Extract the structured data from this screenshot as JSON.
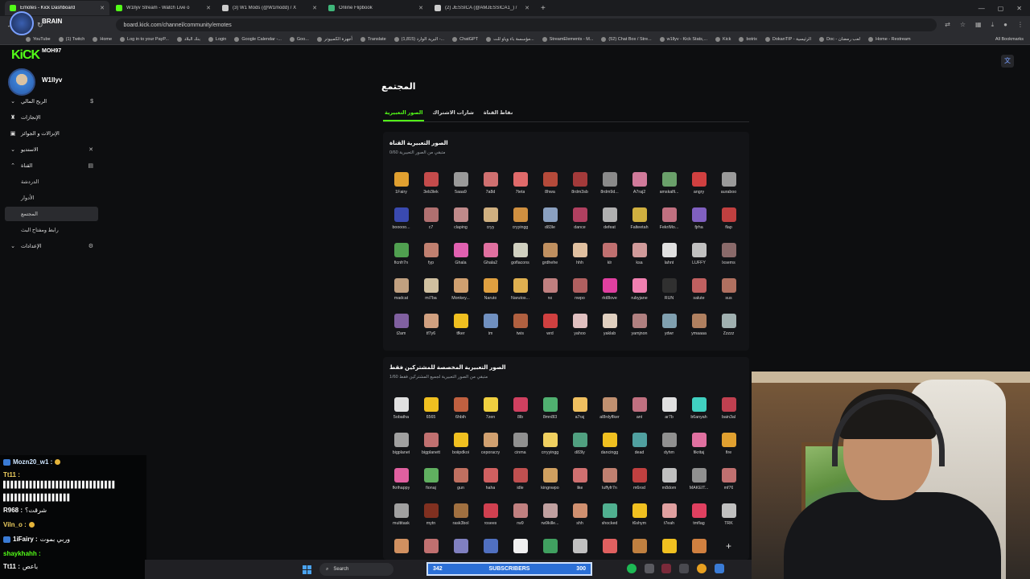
{
  "browser": {
    "tabs": [
      {
        "label": "Emotes - Kick Dashboard",
        "active": true,
        "color": "#53fc18"
      },
      {
        "label": "W1llyv Stream - Watch Live o",
        "active": false,
        "color": "#53fc18"
      },
      {
        "label": "(3) W1 Mods (@W1modd) / X",
        "active": false,
        "color": "#cccccc"
      },
      {
        "label": "Online Flipbook",
        "active": false,
        "color": "#3fb67a"
      },
      {
        "label": "(2) JESSICA (@AMJESSICA1_) /",
        "active": false,
        "color": "#cccccc"
      }
    ],
    "new_tab": "+",
    "url": "board.kick.com/channel/community/emotes",
    "bookmarks": [
      "YouTube",
      "(1) Twitch",
      "Home",
      "Log in to your PayP...",
      "بنك البلاد",
      "Login",
      "Google Calendar -...",
      "Goo...",
      "أجهزة الكمبيوتر",
      "Translate",
      "(1,815) البريد الوارد -...",
      "ChatGPT",
      "مؤسسة باء وياو للت...",
      "StreamElements - M...",
      "(52) Chat Box / Stre...",
      "w1llyv - Kick Stats,...",
      "Kick",
      "botrix",
      "DokanTIP - الرئيسية",
      "Doc - لعب رمضان",
      "Home - Restream"
    ],
    "all_bookmarks": "All Bookmarks"
  },
  "overlay": {
    "top_label": "BRAIN",
    "logo": "KiCK",
    "chatter_label": "MOH97"
  },
  "sidebar": {
    "username": "W1llyv",
    "items": [
      {
        "label": "الربح المالي",
        "icon": "$"
      },
      {
        "label": "الإنجازات",
        "icon": "🏆"
      },
      {
        "label": "الإنزالات و الجوائز",
        "icon": "🎁"
      },
      {
        "label": "الاستديو",
        "icon": "▣"
      },
      {
        "label": "القناة",
        "icon": "▤"
      },
      {
        "label": "الدردشة",
        "icon": ""
      },
      {
        "label": "الأدوار",
        "icon": ""
      },
      {
        "label": "المجتمع",
        "icon": ""
      },
      {
        "label": "رابط ومفتاح البث",
        "icon": ""
      },
      {
        "label": "الإعدادات",
        "icon": "⚙"
      }
    ]
  },
  "main": {
    "title": "المجتمع",
    "tabs": [
      {
        "label": "الصور التعبيرية",
        "active": true
      },
      {
        "label": "شارات الاشتراك",
        "active": false
      },
      {
        "label": "نقاط القناة",
        "active": false
      }
    ],
    "channel_emotes": {
      "title": "الصور التعبيرية القناة",
      "subtitle": "متبقي من الصور التعبيرية 0/60",
      "emotes": [
        {
          "name": "1Fairy",
          "color": "#e0a030"
        },
        {
          "name": "3eb3lek",
          "color": "#c44b4b"
        },
        {
          "name": "5aaa9",
          "color": "#9a9a9a"
        },
        {
          "name": "7a8d",
          "color": "#d07070"
        },
        {
          "name": "7teta",
          "color": "#e06a6a"
        },
        {
          "name": "8hwa",
          "color": "#b54a3a"
        },
        {
          "name": "8rdm3sb",
          "color": "#a33a3a"
        },
        {
          "name": "8rdm9d...",
          "color": "#8a8a8a"
        },
        {
          "name": "A7raj2",
          "color": "#d07a9a"
        },
        {
          "name": "amskalfi...",
          "color": "#6aa06a"
        },
        {
          "name": "angry",
          "color": "#d04040"
        },
        {
          "name": "auraboo",
          "color": "#9a9a9a"
        },
        {
          "name": "booooo...",
          "color": "#3a4ab0"
        },
        {
          "name": "c7",
          "color": "#b07070"
        },
        {
          "name": "claping",
          "color": "#c08a8a"
        },
        {
          "name": "cryy",
          "color": "#d0b080"
        },
        {
          "name": "cryyingg",
          "color": "#d09040"
        },
        {
          "name": "d83le",
          "color": "#8aa0c0"
        },
        {
          "name": "dance",
          "color": "#b04060"
        },
        {
          "name": "defeat",
          "color": "#b0b0b0"
        },
        {
          "name": "Falteetah",
          "color": "#d0b040"
        },
        {
          "name": "FekriMo...",
          "color": "#c07080"
        },
        {
          "name": "fjrha",
          "color": "#8060c0"
        },
        {
          "name": "flap",
          "color": "#c04040"
        },
        {
          "name": "ficnfr7n",
          "color": "#50a050"
        },
        {
          "name": "fyp",
          "color": "#c08070"
        },
        {
          "name": "Ghala",
          "color": "#e060b0"
        },
        {
          "name": "Ghala2",
          "color": "#e070a0"
        },
        {
          "name": "goflacons",
          "color": "#d0d0c0"
        },
        {
          "name": "grdhehe",
          "color": "#c09060"
        },
        {
          "name": "hhh",
          "color": "#e0c0a0"
        },
        {
          "name": "klr",
          "color": "#c07070"
        },
        {
          "name": "ksa",
          "color": "#d09a9a"
        },
        {
          "name": "lahnt",
          "color": "#e0e0e0"
        },
        {
          "name": "LUFFY",
          "color": "#c0c0c0"
        },
        {
          "name": "lxsems",
          "color": "#8a6a6a"
        },
        {
          "name": "madcat",
          "color": "#c0a080"
        },
        {
          "name": "mi7ba",
          "color": "#d0c0a0"
        },
        {
          "name": "Monkey...",
          "color": "#d0a070"
        },
        {
          "name": "Naruto",
          "color": "#e0a040"
        },
        {
          "name": "Narutos...",
          "color": "#e0b050"
        },
        {
          "name": "no",
          "color": "#c08080"
        },
        {
          "name": "nwpo",
          "color": "#b06060"
        },
        {
          "name": "rkt8love",
          "color": "#e040a0"
        },
        {
          "name": "rubyjane",
          "color": "#f080b0"
        },
        {
          "name": "RUN",
          "color": "#303030"
        },
        {
          "name": "salute",
          "color": "#c06060"
        },
        {
          "name": "sus",
          "color": "#b07060"
        },
        {
          "name": "t2am",
          "color": "#8060a0"
        },
        {
          "name": "tf7y6",
          "color": "#d0a080"
        },
        {
          "name": "tfker",
          "color": "#f0c020"
        },
        {
          "name": "tm",
          "color": "#7090c0"
        },
        {
          "name": "twis",
          "color": "#b06040"
        },
        {
          "name": "wrd",
          "color": "#d04040"
        },
        {
          "name": "yahoo",
          "color": "#e0c0c0"
        },
        {
          "name": "yaklab",
          "color": "#e0d0c0"
        },
        {
          "name": "yamjnon",
          "color": "#b08080"
        },
        {
          "name": "ydwr",
          "color": "#80a0b0"
        },
        {
          "name": "ymaaaa",
          "color": "#b08060"
        },
        {
          "name": "Zzzzz",
          "color": "#a0b0b0"
        }
      ]
    },
    "subscriber_emotes": {
      "title": "الصور التعبيرية المخصصة للمشتركين فقط",
      "subtitle": "متبقي من الصور التعبيرية لجميع المشتركين فقط 1/60",
      "emotes": [
        {
          "name": "5obatha",
          "color": "#e0e0e0"
        },
        {
          "name": "6565",
          "color": "#f0c020"
        },
        {
          "name": "6hbih",
          "color": "#c06040"
        },
        {
          "name": "7zen",
          "color": "#f0d040"
        },
        {
          "name": "8lb",
          "color": "#d04060"
        },
        {
          "name": "8mn8l3",
          "color": "#50b070"
        },
        {
          "name": "a7raj",
          "color": "#f0c060"
        },
        {
          "name": "al8rdyflker",
          "color": "#c09070"
        },
        {
          "name": "ant",
          "color": "#c07080"
        },
        {
          "name": "ar7b",
          "color": "#e0e0e0"
        },
        {
          "name": "b6anyah",
          "color": "#40d0c0"
        },
        {
          "name": "bain3al",
          "color": "#c04050"
        },
        {
          "name": "bigplanet",
          "color": "#a0a0a0"
        },
        {
          "name": "bigplanett",
          "color": "#c07070"
        },
        {
          "name": "boiipdkoi",
          "color": "#f0c020"
        },
        {
          "name": "ceporacry",
          "color": "#d0a070"
        },
        {
          "name": "cinma",
          "color": "#909090"
        },
        {
          "name": "crryyingg",
          "color": "#f0d060"
        },
        {
          "name": "d83ly",
          "color": "#50a080"
        },
        {
          "name": "dancingg",
          "color": "#f0c020"
        },
        {
          "name": "dead",
          "color": "#50a0a0"
        },
        {
          "name": "dyhm",
          "color": "#909090"
        },
        {
          "name": "fikritaj",
          "color": "#e070a0"
        },
        {
          "name": "fire",
          "color": "#e0a030"
        },
        {
          "name": "fkrihappy",
          "color": "#e060a0"
        },
        {
          "name": "fionaj",
          "color": "#60b060"
        },
        {
          "name": "gun",
          "color": "#c07060"
        },
        {
          "name": "haha",
          "color": "#d06060"
        },
        {
          "name": "idle",
          "color": "#c05050"
        },
        {
          "name": "kingnwpo",
          "color": "#d0a060"
        },
        {
          "name": "like",
          "color": "#d07070"
        },
        {
          "name": "luffyfr7n",
          "color": "#c08070"
        },
        {
          "name": "m6rod",
          "color": "#c04040"
        },
        {
          "name": "m8dom",
          "color": "#c0c0c0"
        },
        {
          "name": "MAKEIT...",
          "color": "#909090"
        },
        {
          "name": "mf76",
          "color": "#c07070"
        },
        {
          "name": "multitask",
          "color": "#a0a0a0"
        },
        {
          "name": "mytn",
          "color": "#803020"
        },
        {
          "name": "rask3bol",
          "color": "#a07040"
        },
        {
          "name": "rosees",
          "color": "#d04050"
        },
        {
          "name": "rw9",
          "color": "#c08080"
        },
        {
          "name": "rw9kille...",
          "color": "#c0a0a0"
        },
        {
          "name": "shh",
          "color": "#d09070"
        },
        {
          "name": "shocked",
          "color": "#50b090"
        },
        {
          "name": "t6shym",
          "color": "#f0c020"
        },
        {
          "name": "t7eah",
          "color": "#e0a0a0"
        },
        {
          "name": "tmflag",
          "color": "#e04060"
        },
        {
          "name": "TRK",
          "color": "#c0c0c0"
        },
        {
          "name": "",
          "color": "#d09060"
        },
        {
          "name": "",
          "color": "#c07070"
        },
        {
          "name": "",
          "color": "#8080c0"
        },
        {
          "name": "",
          "color": "#5070c0"
        },
        {
          "name": "",
          "color": "#f0f0f0"
        },
        {
          "name": "",
          "color": "#40a060"
        },
        {
          "name": "",
          "color": "#c0c0c0"
        },
        {
          "name": "",
          "color": "#e06060"
        },
        {
          "name": "",
          "color": "#c08040"
        },
        {
          "name": "",
          "color": "#f0c020"
        },
        {
          "name": "",
          "color": "#d08040"
        },
        {
          "name": "+",
          "color": "transparent"
        }
      ]
    }
  },
  "chat": [
    {
      "name": "Mozn20_w1 :",
      "text": "",
      "color": "#cfe6ff",
      "emoji": true,
      "badge": true
    },
    {
      "name": "Tt11 :",
      "text": "",
      "color": "#f0d060",
      "emoji": false,
      "badge": false
    },
    {
      "name": "",
      "text": "▌▌▌▌▌▌▌▌▌▌▌▌▌▌▌▌▌▌▌▌▌▌▌▌▌▌▌▌▌▌",
      "color": "#ffffff",
      "emoji": false,
      "badge": false
    },
    {
      "name": "",
      "text": "▌▌▌▌▌▌▌▌▌▌▌▌▌▌▌▌▌▌",
      "color": "#ffffff",
      "emoji": false,
      "badge": false
    },
    {
      "name": "R968 :",
      "text": "شرقت؟",
      "color": "#ffffff",
      "emoji": false,
      "badge": false
    },
    {
      "name": "Viln_o :",
      "text": "",
      "color": "#f0d060",
      "emoji": true,
      "badge": false
    },
    {
      "name": "1iFairy :",
      "text": "وربي بموت",
      "color": "#ffffff",
      "emoji": false,
      "badge": true
    },
    {
      "name": "shaykhahh :",
      "text": "",
      "color": "#53fc18",
      "emoji": false,
      "badge": false
    },
    {
      "name": "Tt11 :",
      "text": "باعص",
      "color": "#ffffff",
      "emoji": false,
      "badge": false
    }
  ],
  "taskbar": {
    "search": "Search"
  },
  "subs_goal": {
    "current": "342",
    "label": "SUBSCRIBERS",
    "target": "300"
  }
}
